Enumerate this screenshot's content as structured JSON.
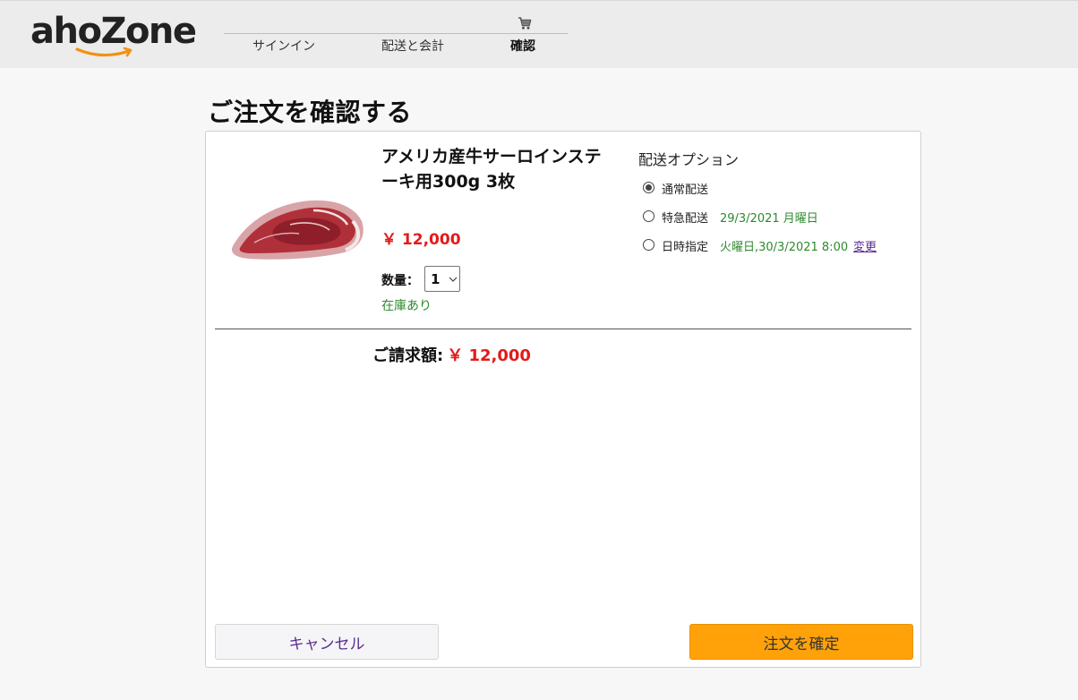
{
  "header": {
    "logo_text": "ahoZone",
    "steps": [
      "サインイン",
      "配送と会計",
      "確認"
    ],
    "active_step": 2
  },
  "page": {
    "title": "ご注文を確認する"
  },
  "product": {
    "title": "アメリカ産牛サーロインステーキ用300g 3枚",
    "price": "￥ 12,000",
    "qty_label": "数量：",
    "qty_value": "1",
    "stock": "在庫あり"
  },
  "shipping": {
    "title": "配送オプション",
    "options": [
      {
        "label": "通常配送",
        "date": "",
        "selected": true
      },
      {
        "label": "特急配送",
        "date": "29/3/2021 月曜日",
        "selected": false
      },
      {
        "label": "日時指定",
        "date": "火曜日,30/3/2021 8:00",
        "selected": false,
        "link": "変更"
      }
    ]
  },
  "total": {
    "label": "ご請求額:",
    "amount": "￥ 12,000"
  },
  "buttons": {
    "cancel": "キャンセル",
    "confirm": "注文を確定"
  },
  "colors": {
    "accent_orange": "#ffa20a",
    "price_red": "#e31a1a",
    "stock_green": "#2d8a2d",
    "step_line_yellow": "#f0c419",
    "link_purple": "#5a2d8e"
  }
}
